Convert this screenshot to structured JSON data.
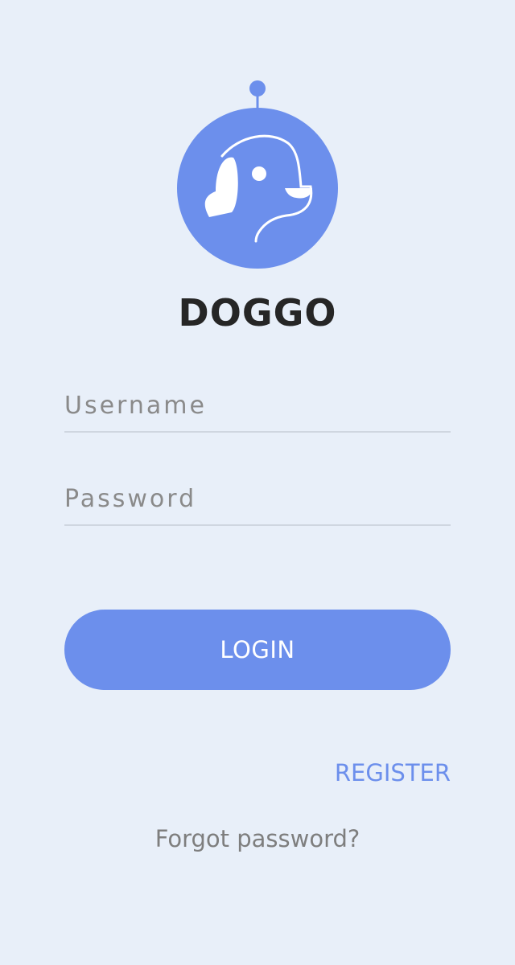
{
  "app": {
    "name": "DOGGO"
  },
  "logo": {
    "icon": "dog-face-icon"
  },
  "form": {
    "username_placeholder": "Username",
    "username_value": "",
    "password_placeholder": "Password",
    "password_value": ""
  },
  "actions": {
    "login_label": "LOGIN",
    "register_label": "REGISTER",
    "forgot_label": "Forgot password?"
  },
  "colors": {
    "background": "#e8eff9",
    "accent": "#6c8fec",
    "text_dark": "#262626",
    "text_muted": "#8a8a8a"
  }
}
